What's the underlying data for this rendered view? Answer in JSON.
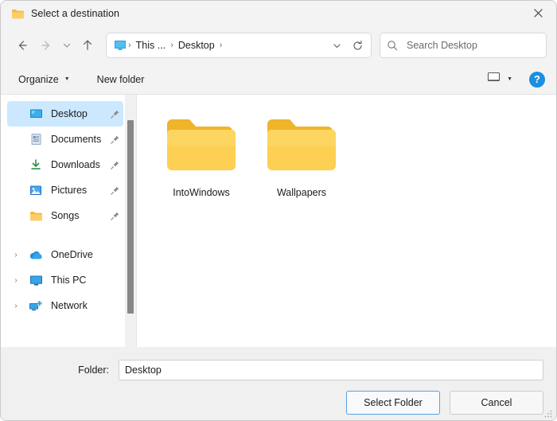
{
  "window": {
    "title": "Select a destination",
    "title_icon": "folder-icon",
    "close_label": "✕"
  },
  "navbar": {
    "back_icon": "arrow-left-icon",
    "forward_icon": "arrow-right-icon",
    "recent_icon": "chevron-down-icon",
    "up_icon": "arrow-up-icon",
    "breadcrumb": {
      "icon": "this-pc-icon",
      "items": [
        "This ...",
        "Desktop"
      ],
      "separator": "›",
      "dropdown_icon": "chevron-down-icon",
      "refresh_icon": "refresh-icon"
    },
    "search": {
      "icon": "search-icon",
      "placeholder": "Search Desktop",
      "value": ""
    }
  },
  "commandbar": {
    "organize_label": "Organize",
    "organize_caret": "▼",
    "new_folder_label": "New folder",
    "view_icon": "view-monitor-icon",
    "view_caret": "▼",
    "help_label": "?"
  },
  "sidebar": {
    "quick_access": [
      {
        "label": "Desktop",
        "icon": "desktop-icon",
        "pinned": true,
        "selected": true
      },
      {
        "label": "Documents",
        "icon": "documents-icon",
        "pinned": true,
        "selected": false
      },
      {
        "label": "Downloads",
        "icon": "downloads-icon",
        "pinned": true,
        "selected": false
      },
      {
        "label": "Pictures",
        "icon": "pictures-icon",
        "pinned": true,
        "selected": false
      },
      {
        "label": "Songs",
        "icon": "folder-icon",
        "pinned": true,
        "selected": false
      }
    ],
    "tree": [
      {
        "label": "OneDrive",
        "icon": "onedrive-cloud-icon",
        "expand": "›"
      },
      {
        "label": "This PC",
        "icon": "this-pc-icon",
        "expand": "›"
      },
      {
        "label": "Network",
        "icon": "network-icon",
        "expand": "›"
      }
    ]
  },
  "filepane": {
    "items": [
      {
        "name": "IntoWindows",
        "icon": "folder-icon"
      },
      {
        "name": "Wallpapers",
        "icon": "folder-icon"
      }
    ]
  },
  "footer": {
    "folder_label": "Folder:",
    "folder_value": "Desktop",
    "folder_placeholder": "",
    "select_button": "Select Folder",
    "cancel_button": "Cancel"
  },
  "colors": {
    "accent": "#0078d4",
    "selection": "#cce8ff",
    "folder_yellow": "#f7c948",
    "help_blue": "#1b8fe0"
  }
}
